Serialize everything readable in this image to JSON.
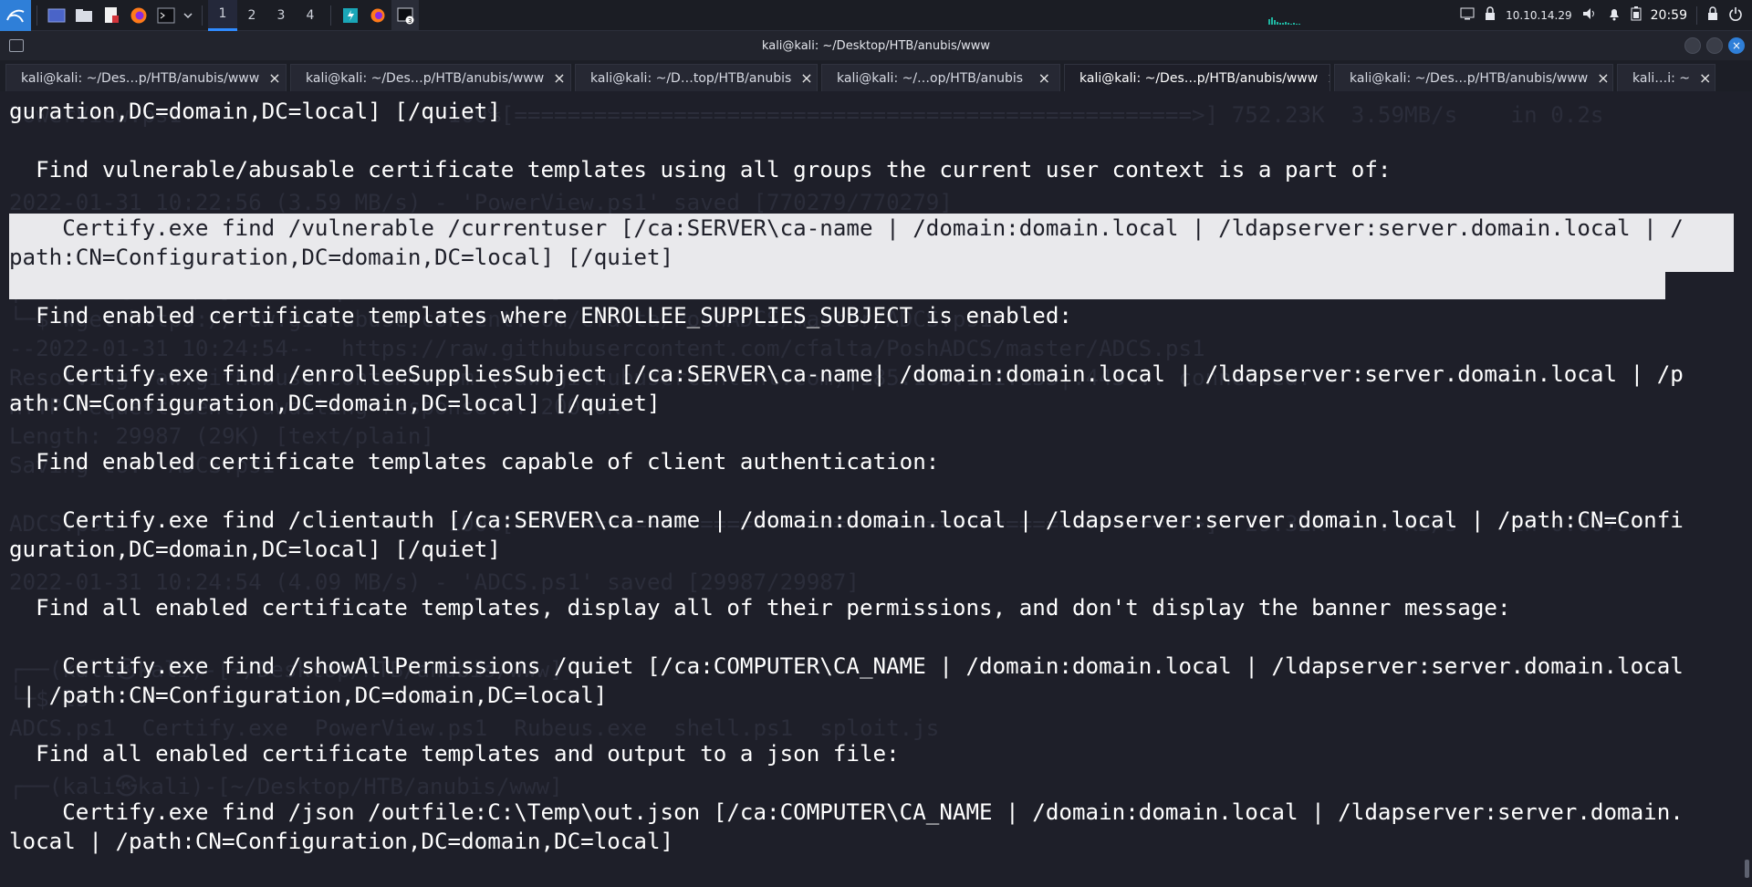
{
  "taskbar": {
    "workspaces": [
      "1",
      "2",
      "3",
      "4"
    ],
    "active_workspace": "1",
    "ip": "10.10.14.29",
    "clock": "20:59",
    "icons": [
      "kali-menu-icon",
      "show-desktop-icon",
      "file-manager-icon",
      "text-editor-icon",
      "firefox-icon",
      "terminal-icon",
      "dropdown-chevron-icon",
      "burp-icon",
      "firefox-icon",
      "terminal-badge-icon",
      "monitor-icon",
      "lock-network-icon",
      "volume-icon",
      "bell-icon",
      "battery-icon",
      "lock-icon",
      "power-icon"
    ]
  },
  "window": {
    "title": "kali@kali: ~/Desktop/HTB/anubis/www"
  },
  "tabs": [
    {
      "label": "kali@kali: ~/Des…p/HTB/anubis/www"
    },
    {
      "label": "kali@kali: ~/Des…p/HTB/anubis/www"
    },
    {
      "label": "kali@kali: ~/D…top/HTB/anubis"
    },
    {
      "label": "kali@kali: ~/…op/HTB/anubis"
    },
    {
      "label": "kali@kali: ~/Des…p/HTB/anubis/www"
    },
    {
      "label": "kali@kali: ~/Des…p/HTB/anubis/www"
    },
    {
      "label": "kali…i: ~"
    }
  ],
  "active_tab": 4,
  "terminal": {
    "background_lines": [
      "PowerView.ps1                    100%[===================================================>] 752.23K  3.59MB/s    in 0.2s",
      "2022-01-31 10:22:56 (3.59 MB/s) - 'PowerView.ps1' saved [770279/770279]",
      "┌──(kali㉿kali)-[~/Desktop/HTB/anubis/www]",
      "└─$ wget https://raw.githubusercontent.com/cfalta/PoshADCS/master/ADCS.ps1",
      "--2022-01-31 10:24:54--  https://raw.githubusercontent.com/cfalta/PoshADCS/master/ADCS.ps1",
      "Resolving raw.githubusercontent.com (raw.githubusercontent.com)|185.199.111.133|:443... connected.",
      "HTTP request sent, awaiting response... 200 OK",
      "Length: 29987 (29K) [text/plain]",
      "Saving to: 'ADCS.ps1'",
      "ADCS.ps1                         100%[===================================================>]  29.32K  --.-KB/s    in 0.007s",
      "2022-01-31 10:24:54 (4.09 MB/s) - 'ADCS.ps1' saved [29987/29987]",
      "┌──(kali㉿kali)-[~/Desktop/HTB/anubis/www]",
      "└─$ ls",
      "ADCS.ps1  Certify.exe  PowerView.ps1  Rubeus.exe  shell.ps1  sploit.js",
      "┌──(kali㉿kali)-[~/Desktop/HTB/anubis/www]"
    ],
    "lines": [
      "guration,DC=domain,DC=local] [/quiet]",
      "",
      "  Find vulnerable/abusable certificate templates using all groups the current user context is a part of:",
      "",
      "    Certify.exe find /vulnerable /currentuser [/ca:SERVER\\ca-name | /domain:domain.local | /ldapserver:server.domain.local | /",
      "path:CN=Configuration,DC=domain,DC=local] [/quiet]",
      "",
      "  Find enabled certificate templates where ENROLLEE_SUPPLIES_SUBJECT is enabled:",
      "",
      "    Certify.exe find /enrolleeSuppliesSubject [/ca:SERVER\\ca-name| /domain:domain.local | /ldapserver:server.domain.local | /p",
      "ath:CN=Configuration,DC=domain,DC=local] [/quiet]",
      "",
      "  Find enabled certificate templates capable of client authentication:",
      "",
      "    Certify.exe find /clientauth [/ca:SERVER\\ca-name | /domain:domain.local | /ldapserver:server.domain.local | /path:CN=Confi",
      "guration,DC=domain,DC=local] [/quiet]",
      "",
      "  Find all enabled certificate templates, display all of their permissions, and don't display the banner message:",
      "",
      "    Certify.exe find /showAllPermissions /quiet [/ca:COMPUTER\\CA_NAME | /domain:domain.local | /ldapserver:server.domain.local",
      " | /path:CN=Configuration,DC=domain,DC=local]",
      "",
      "  Find all enabled certificate templates and output to a json file:",
      "",
      "    Certify.exe find /json /outfile:C:\\Temp\\out.json [/ca:COMPUTER\\CA_NAME | /domain:domain.local | /ldapserver:server.domain.",
      "local | /path:CN=Configuration,DC=domain,DC=local]"
    ],
    "highlighted_lines": [
      4,
      5
    ]
  }
}
